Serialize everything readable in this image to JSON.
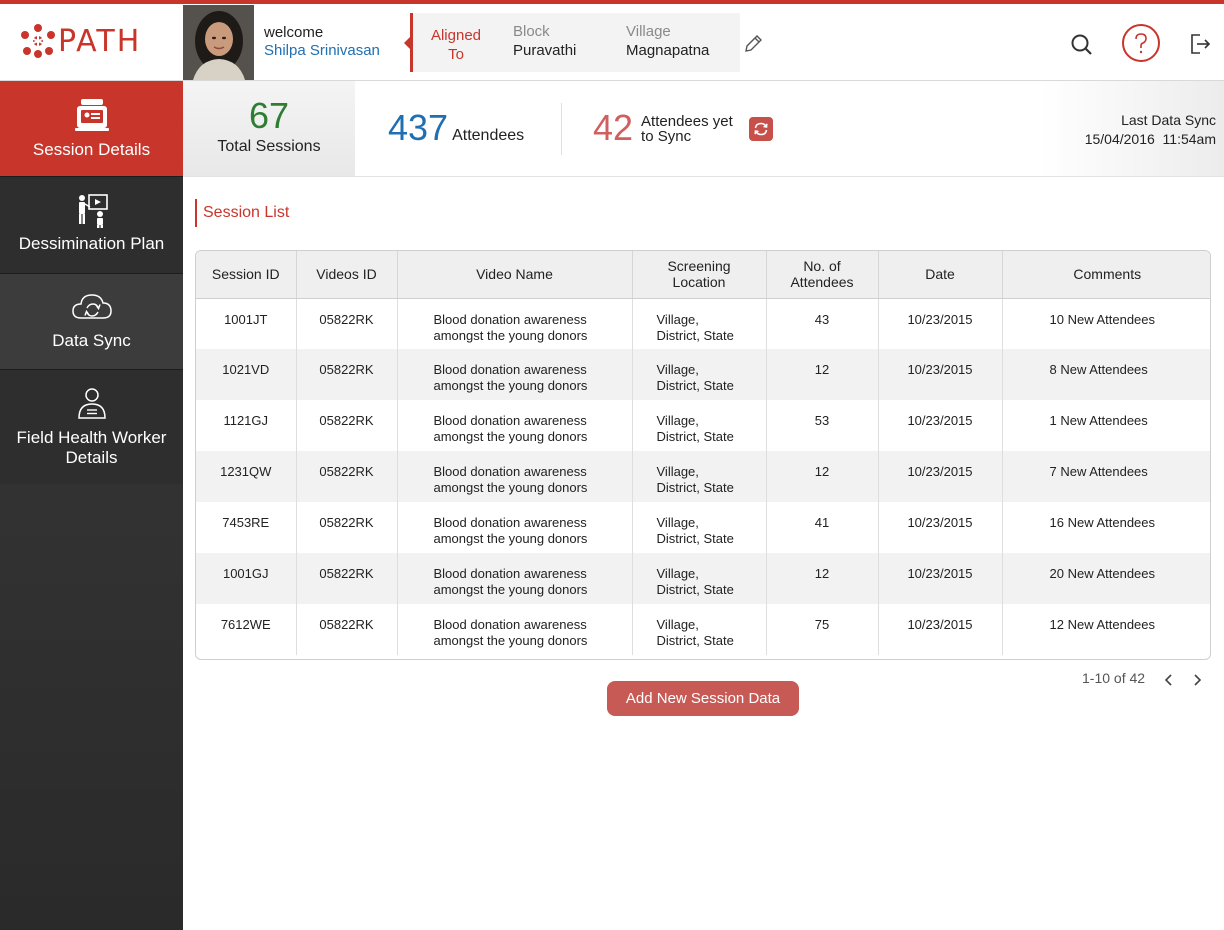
{
  "brand": {
    "name": "PATH",
    "accent": "#c8352b"
  },
  "user": {
    "welcome": "welcome",
    "name": "Shilpa Srinivasan"
  },
  "alignment": {
    "label_line1": "Aligned",
    "label_line2": "To",
    "block_label": "Block",
    "block_value": "Puravathi",
    "village_label": "Village",
    "village_value": "Magnapatna"
  },
  "header_icons": [
    "pencil-icon",
    "search-icon",
    "help-icon",
    "logout-icon"
  ],
  "sidebar": {
    "items": [
      {
        "label": "Session Details",
        "icon": "session-icon",
        "active": true
      },
      {
        "label": "Dessimination Plan",
        "icon": "presentation-icon",
        "active": false
      },
      {
        "label": "Data Sync",
        "icon": "cloud-sync-icon",
        "active": false
      },
      {
        "label": "Field Health Worker Details",
        "label_line1": "Field Health Worker",
        "label_line2": "Details",
        "icon": "worker-icon",
        "active": false
      }
    ]
  },
  "stats": {
    "total_sessions": "67",
    "total_sessions_label": "Total Sessions",
    "attendees": "437",
    "attendees_label": "Attendees",
    "yet_to_sync": "42",
    "yet_to_sync_label_line1": "Attendees yet",
    "yet_to_sync_label_line2": "to Sync",
    "last_sync_label": "Last Data Sync",
    "last_sync_value": "15/04/2016  11:54am"
  },
  "session_list": {
    "title": "Session List",
    "headers": [
      "Session ID",
      "Videos ID",
      "Video Name",
      "Screening Location",
      "No. of Attendees",
      "Date",
      "Comments"
    ],
    "header_lines": [
      [
        "Session ID"
      ],
      [
        "Videos ID"
      ],
      [
        "Video Name"
      ],
      [
        "Screening",
        "Location"
      ],
      [
        "No. of",
        "Attendees"
      ],
      [
        "Date"
      ],
      [
        "Comments"
      ]
    ],
    "rows": [
      {
        "session_id": "1001JT",
        "video_id": "05822RK",
        "video_name_1": "Blood donation awareness",
        "video_name_2": "amongst the young donors",
        "loc_1": "Village,",
        "loc_2": "District, State",
        "attendees": "43",
        "date": "10/23/2015",
        "comments": "10 New Attendees"
      },
      {
        "session_id": "1021VD",
        "video_id": "05822RK",
        "video_name_1": "Blood donation awareness",
        "video_name_2": "amongst the young donors",
        "loc_1": "Village,",
        "loc_2": "District, State",
        "attendees": "12",
        "date": "10/23/2015",
        "comments": "8 New Attendees"
      },
      {
        "session_id": "1121GJ",
        "video_id": "05822RK",
        "video_name_1": "Blood donation awareness",
        "video_name_2": "amongst the young donors",
        "loc_1": "Village,",
        "loc_2": "District, State",
        "attendees": "53",
        "date": "10/23/2015",
        "comments": "1 New Attendees"
      },
      {
        "session_id": "1231QW",
        "video_id": "05822RK",
        "video_name_1": "Blood donation awareness",
        "video_name_2": "amongst the young donors",
        "loc_1": "Village,",
        "loc_2": "District, State",
        "attendees": "12",
        "date": "10/23/2015",
        "comments": "7 New Attendees"
      },
      {
        "session_id": "7453RE",
        "video_id": "05822RK",
        "video_name_1": "Blood donation awareness",
        "video_name_2": "amongst the young donors",
        "loc_1": "Village,",
        "loc_2": "District, State",
        "attendees": "41",
        "date": "10/23/2015",
        "comments": "16 New Attendees"
      },
      {
        "session_id": "1001GJ",
        "video_id": "05822RK",
        "video_name_1": "Blood donation awareness",
        "video_name_2": "amongst the young donors",
        "loc_1": "Village,",
        "loc_2": "District, State",
        "attendees": "12",
        "date": "10/23/2015",
        "comments": "20 New Attendees"
      },
      {
        "session_id": "7612WE",
        "video_id": "05822RK",
        "video_name_1": "Blood donation awareness",
        "video_name_2": "amongst the young donors",
        "loc_1": "Village,",
        "loc_2": "District, State",
        "attendees": "75",
        "date": "10/23/2015",
        "comments": "12 New Attendees"
      }
    ]
  },
  "pagination": {
    "text": "1-10 of 42"
  },
  "actions": {
    "add_session": "Add New Session Data"
  }
}
